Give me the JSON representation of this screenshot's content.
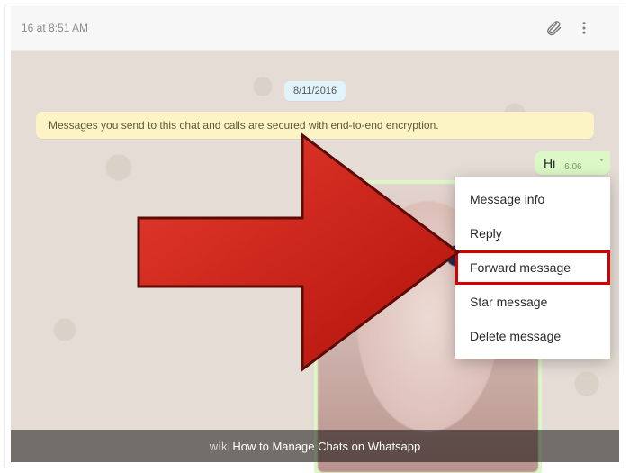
{
  "header": {
    "timestamp_fragment": "16 at 8:51 AM"
  },
  "date_pill": "8/11/2016",
  "encryption_banner": "Messages you send to this chat and calls are secured with end-to-end encryption.",
  "outgoing_message": {
    "text": "Hi",
    "time": "6:06"
  },
  "context_menu": {
    "items": [
      {
        "label": "Message info"
      },
      {
        "label": "Reply"
      },
      {
        "label": "Forward message",
        "highlighted": true
      },
      {
        "label": "Star message"
      },
      {
        "label": "Delete message"
      }
    ]
  },
  "caption": {
    "prefix": "wiki",
    "title": "How to Manage Chats on Whatsapp"
  }
}
